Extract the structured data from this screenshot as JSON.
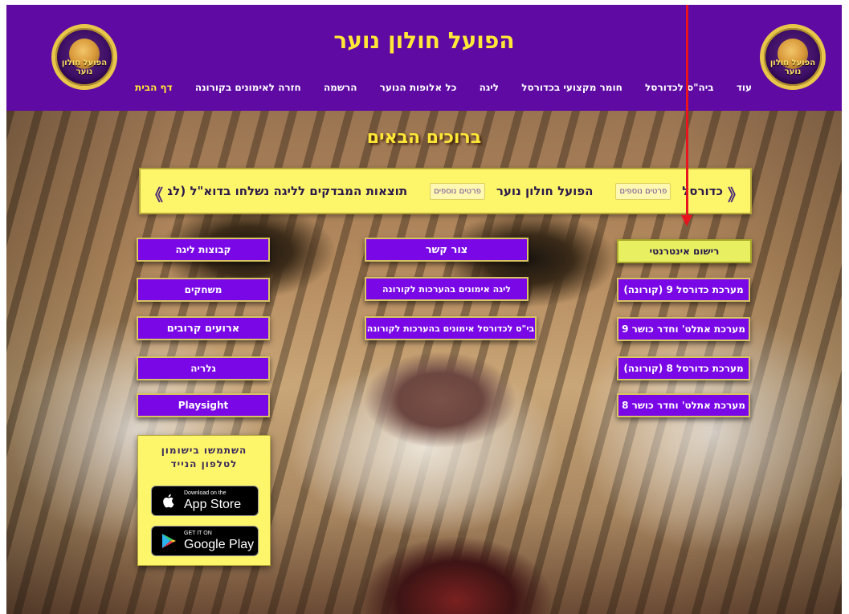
{
  "header": {
    "site_title": "הפועל חולון נוער",
    "logo_text": "הפועל חולון נוער",
    "nav": [
      "דף הבית",
      "חזרה לאימונים בקורונה",
      "הרשמה",
      "כל אלופות הנוער",
      "ליגה",
      "חומר מקצועי בכדורסל",
      "ביה\"ס לכדורסל",
      "עוד"
    ]
  },
  "main": {
    "section_title": "ברוכים הבאים",
    "ticker": {
      "items": [
        {
          "text": "כדורסל",
          "more": "פרטים נוספים"
        },
        {
          "text": "הפועל חולון נוער",
          "more": "פרטים נוספים"
        },
        {
          "text": "תוצאות המבדקים לליגה נשלחו בדוא\"ל (לבז",
          "more": ""
        }
      ],
      "arrow_right": "《",
      "arrow_left": "》"
    },
    "left_column": [
      "קבוצות ליגה",
      "משחקים",
      "ארועים קרובים",
      "גלריה",
      "Playsight"
    ],
    "middle_column": [
      "צור קשר",
      "ליגה אימונים בהערכות לקורונה",
      "בי\"ס לכדורסל אימונים בהערכות לקורונה"
    ],
    "right_column": [
      "רישום אינטרנטי",
      "מערכת כדורסל 9 (קורונה)",
      "מערכת אתלט' וחדר כושר 9",
      "מערכת כדורסל 8 (קורונה)",
      "מערכת אתלט' וחדר כושר 8"
    ]
  },
  "app_box": {
    "title_line1": "השתמשו בישומון",
    "title_line2": "לטלפון הנייד",
    "apple_small": "Download on the",
    "apple_big": "App Store",
    "google_small": "GET IT ON",
    "google_big": "Google Play"
  },
  "colors": {
    "header_bg": "#5e0aa3",
    "title_yellow": "#ffe838",
    "button_purple": "#7a08e6",
    "button_yellow": "#e8f062",
    "ticker_bg": "#fdf56a",
    "annotation_red": "#e8141e"
  }
}
